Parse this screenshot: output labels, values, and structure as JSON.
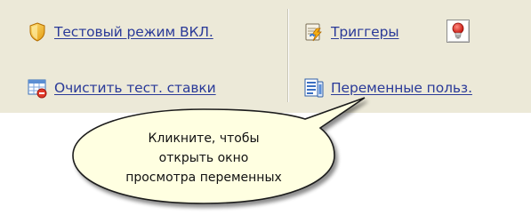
{
  "toolbar": {
    "test_mode_label": "Тестовый режим ВКЛ.",
    "clear_bets_label": "Очистить тест. ставки",
    "triggers_label": "Триггеры",
    "variables_label": "Переменные польз."
  },
  "callout": {
    "line1": "Кликните, чтобы",
    "line2": "открыть окно",
    "line3": "просмотра переменных"
  },
  "icons": {
    "test_mode": "shield-icon",
    "clear_bets": "table-delete-icon",
    "triggers": "lightning-document-icon",
    "trigger_toggle": "red-lightbulb-icon",
    "variables": "variables-list-icon"
  },
  "colors": {
    "toolbar_bg": "#ece9d8",
    "link": "#2a3a98",
    "callout_fill": "#ffffe1"
  }
}
